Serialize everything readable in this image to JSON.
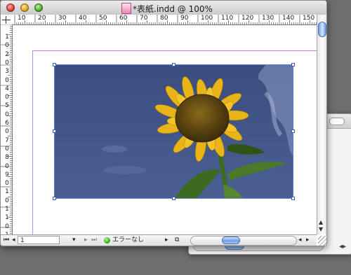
{
  "window": {
    "title": "*表紙.indd @ 100%"
  },
  "rulers": {
    "horizontal": [
      "10",
      "20",
      "30",
      "40",
      "50",
      "60",
      "70",
      "80",
      "90",
      "100",
      "110",
      "120",
      "130",
      "140",
      "150",
      "160",
      "170"
    ],
    "vertical": [
      "1",
      "0",
      "2",
      "0",
      "3",
      "0",
      "4",
      "0",
      "5",
      "0",
      "6",
      "0",
      "7",
      "0",
      "8",
      "0",
      "9",
      "0",
      "1",
      "0",
      "1",
      "1",
      "0",
      "1"
    ]
  },
  "photo": {
    "subject": "sunflower against blue sky",
    "sky_color": "#3f5383",
    "selection_color": "#3b5fb3"
  },
  "statusbar": {
    "first_page_icon": "first-page-icon",
    "prev_page_icon": "prev-page-icon",
    "page_number": "1",
    "page_menu_icon": "dropdown-arrow-icon",
    "next_page_icon": "next-page-icon",
    "last_page_icon": "last-page-icon",
    "preflight_status": "エラーなし",
    "preflight_menu_icon": "right-arrow-icon",
    "preview_icon": "preview-mode-icon",
    "scroll_left_icon": "scroll-left-icon",
    "scroll_right_icon": "scroll-right-icon"
  },
  "colors": {
    "accent_blue": "#6c9de5",
    "ok_green": "#2fb015",
    "margin_magenta": "#c77ad0",
    "margin_violet": "#9da0e8"
  }
}
